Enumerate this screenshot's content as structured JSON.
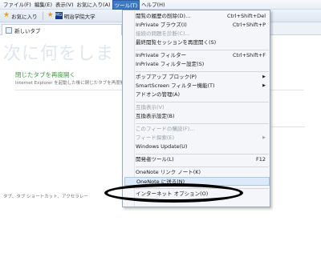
{
  "menubar": {
    "items": [
      {
        "label": "ファイル(F)"
      },
      {
        "label": "編集(E)"
      },
      {
        "label": "表示(V)"
      },
      {
        "label": "お気に入り(A)"
      },
      {
        "label": "ツール(T)"
      },
      {
        "label": "ヘルプ(H)"
      }
    ]
  },
  "favorites": {
    "favorites_label": "お気に入り",
    "site_label": "明治学院大学",
    "site_logo": "MG"
  },
  "tab": {
    "label": "新しいタブ"
  },
  "page": {
    "big_title": "次に何をしま",
    "reopen_link": "閉じたタブを再度開く",
    "reopen_desc": "Internet Explorer を起動した後に閉じたタブを再度開くことができます。",
    "footer_hint": "タブ、タブ ショートカット、アクセラレー"
  },
  "tools_menu": {
    "items": [
      {
        "label": "閲覧の履歴の削除(D)...",
        "shortcut": "Ctrl+Shift+Del"
      },
      {
        "label": "InPrivate ブラウズ(I)",
        "shortcut": "Ctrl+Shift+P"
      },
      {
        "label": "接続の問題を診断(C)..."
      },
      {
        "label": "最終閲覧セッションを再度開く(S)"
      },
      {
        "label": "InPrivate フィルター",
        "shortcut": "Ctrl+Shift+F"
      },
      {
        "label": "InPrivate フィルター設定(S)"
      },
      {
        "label": "ポップアップ ブロック(P)"
      },
      {
        "label": "SmartScreen フィルター機能(T)"
      },
      {
        "label": "アドオンの管理(A)"
      },
      {
        "label": "互換表示(V)"
      },
      {
        "label": "互換表示設定(B)"
      },
      {
        "label": "このフィードの購読(F)..."
      },
      {
        "label": "フィード探索(E)"
      },
      {
        "label": "Windows Update(U)"
      },
      {
        "label": "開発者ツール(L)",
        "shortcut": "F12"
      },
      {
        "label": "OneNote リンク ノート(K)"
      },
      {
        "label": "OneNote に送る(N)"
      },
      {
        "label": "インターネット オプション(O)"
      }
    ]
  },
  "colors": {
    "menu_active": "#3e79c5",
    "link_green": "#3c9a3a",
    "annotation": "#000000"
  }
}
